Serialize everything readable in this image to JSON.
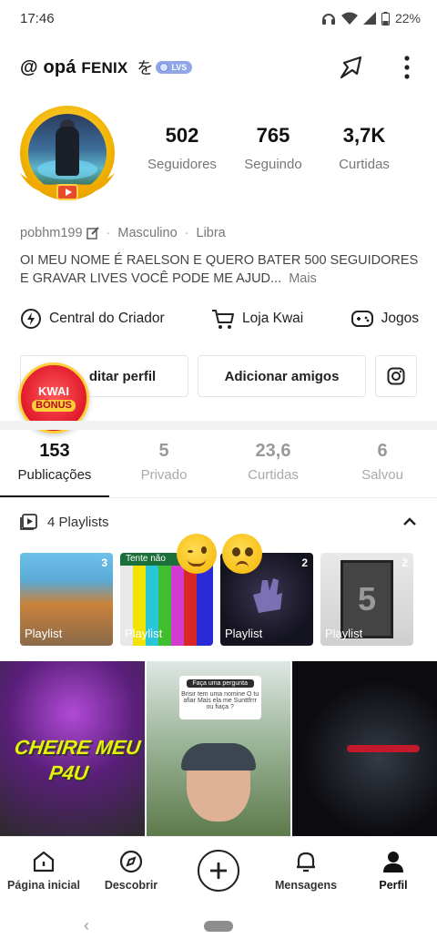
{
  "status_bar": {
    "time": "17:46",
    "battery": "22%"
  },
  "profile": {
    "username": "@ opá",
    "username_caps": "FENIX",
    "badge_kana": "を",
    "level_badge": "LVS",
    "stats": [
      {
        "value": "502",
        "label": "Seguidores"
      },
      {
        "value": "765",
        "label": "Seguindo"
      },
      {
        "value": "3,7K",
        "label": "Curtidas"
      }
    ],
    "handle": "pobhm199",
    "gender": "Masculino",
    "sign": "Libra",
    "bio": "OI MEU NOME É RAELSON E QUERO BATER 500 SEGUIDORES E GRAVAR LIVES VOCÊ PODE ME AJUD...",
    "bio_more": "Mais"
  },
  "shortcuts": [
    {
      "label": "Central do Criador",
      "icon": "lightning-icon"
    },
    {
      "label": "Loja Kwai",
      "icon": "cart-icon"
    },
    {
      "label": "Jogos",
      "icon": "gamepad-icon"
    }
  ],
  "actions": {
    "edit_profile": "ditar perfil",
    "add_friends": "Adicionar amigos"
  },
  "kwai_bonus": {
    "line1": "KWAI",
    "line2": "BÔNUS"
  },
  "tabs": [
    {
      "count": "153",
      "label": "Publicações"
    },
    {
      "count": "5",
      "label": "Privado"
    },
    {
      "count": "23,6",
      "label": "Curtidas"
    },
    {
      "count": "6",
      "label": "Salvou"
    }
  ],
  "playlists_header": "4 Playlists",
  "playlists": [
    {
      "label": "Playlist",
      "count": "3"
    },
    {
      "label": "Playlist",
      "count": "",
      "top_text": "Tente não"
    },
    {
      "label": "Playlist",
      "count": "2"
    },
    {
      "label": "Playlist",
      "count": "2",
      "film_number": "5"
    }
  ],
  "videos": [
    {
      "caption1": "CHEIRE MEU",
      "caption2": "P4U"
    },
    {
      "question_title": "Faça uma pergunta",
      "question_text": "Brisir tem uma nomine O tu afiar Mais ela me Sunttfrrr ou fiaça ?"
    },
    {}
  ],
  "bottom_nav": [
    {
      "label": "Página inicial",
      "icon": "home-icon"
    },
    {
      "label": "Descobrir",
      "icon": "compass-icon"
    },
    {
      "label": "",
      "icon": "plus-icon"
    },
    {
      "label": "Mensagens",
      "icon": "bell-icon"
    },
    {
      "label": "Perfil",
      "icon": "person-icon"
    }
  ],
  "colors": {
    "accent": "#111111",
    "bonus_red": "#e0182a",
    "bonus_gold": "#ffcf3a"
  }
}
